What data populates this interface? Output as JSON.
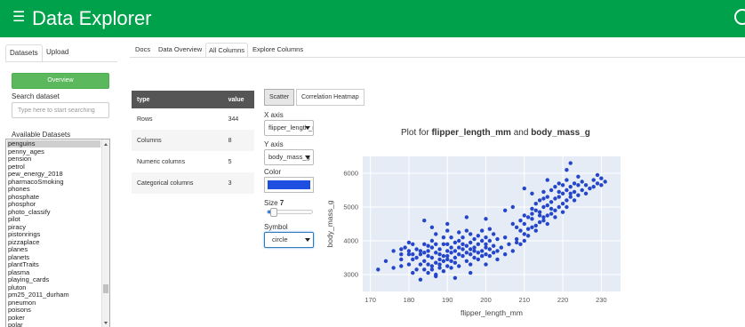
{
  "app": {
    "title": "Data Explorer"
  },
  "sidebar": {
    "tabs": [
      "Datasets",
      "Upload"
    ],
    "overview_button": "Overview",
    "search_label": "Search dataset",
    "search_placeholder": "Type here to start searching",
    "available_label": "Available Datasets",
    "datasets": [
      "penguins",
      "penny_ages",
      "pension",
      "petrol",
      "pew_energy_2018",
      "pharmacoSmoking",
      "phones",
      "phosphate",
      "phosphor",
      "photo_classify",
      "pilot",
      "piracy",
      "pistonrings",
      "pizzaplace",
      "planes",
      "planets",
      "plantTraits",
      "plasma",
      "playing_cards",
      "pluton",
      "pm25_2011_durham",
      "pneumon",
      "poisons",
      "poker",
      "polar"
    ],
    "selected": "penguins"
  },
  "main_tabs": [
    "Docs",
    "Data Overview",
    "All Columns",
    "Explore Columns"
  ],
  "active_main_tab": "All Columns",
  "summary_table": {
    "headers": [
      "type",
      "value"
    ],
    "rows": [
      [
        "Rows",
        "344"
      ],
      [
        "Columns",
        "8"
      ],
      [
        "Numeric columns",
        "5"
      ],
      [
        "Categorical columns",
        "3"
      ]
    ]
  },
  "controls": {
    "tabs": [
      "Scatter",
      "Correlation Heatmap"
    ],
    "x_label": "X axis",
    "x_value": "flipper_length_mm",
    "y_label": "Y axis",
    "y_value": "body_mass_g",
    "color_label": "Color",
    "color_value": "#1f4fe0",
    "size_label": "Size",
    "size_value": "7",
    "size_fraction": 0.12,
    "symbol_label": "Symbol",
    "symbol_value": "circle"
  },
  "plot": {
    "title_prefix": "Plot for ",
    "title_x": "flipper_length_mm",
    "title_and": " and ",
    "title_y": "body_mass_g"
  },
  "chart_data": {
    "type": "scatter",
    "title": "Plot for flipper_length_mm and body_mass_g",
    "xlabel": "flipper_length_mm",
    "ylabel": "body_mass_g",
    "xlim": [
      168,
      235
    ],
    "ylim": [
      2500,
      6500
    ],
    "xticks": [
      170,
      180,
      190,
      200,
      210,
      220,
      230
    ],
    "yticks": [
      3000,
      4000,
      5000,
      6000
    ],
    "grid": true,
    "marker_color": "#2546c9",
    "background": "#e5ecf6",
    "points": [
      [
        172,
        3150
      ],
      [
        174,
        3400
      ],
      [
        176,
        3200
      ],
      [
        178,
        3250
      ],
      [
        178,
        3600
      ],
      [
        178,
        3450
      ],
      [
        179,
        3800
      ],
      [
        180,
        3700
      ],
      [
        180,
        3300
      ],
      [
        180,
        3600
      ],
      [
        180,
        3950
      ],
      [
        181,
        3450
      ],
      [
        181,
        3600
      ],
      [
        181,
        3050
      ],
      [
        182,
        3150
      ],
      [
        182,
        3500
      ],
      [
        182,
        3750
      ],
      [
        183,
        3600
      ],
      [
        183,
        3300
      ],
      [
        183,
        3700
      ],
      [
        184,
        3400
      ],
      [
        184,
        3150
      ],
      [
        184,
        3650
      ],
      [
        184,
        3900
      ],
      [
        185,
        3300
      ],
      [
        185,
        3550
      ],
      [
        185,
        3700
      ],
      [
        185,
        3050
      ],
      [
        185,
        3850
      ],
      [
        186,
        3500
      ],
      [
        186,
        3800
      ],
      [
        186,
        3250
      ],
      [
        186,
        3150
      ],
      [
        186,
        4000
      ],
      [
        187,
        3350
      ],
      [
        187,
        3650
      ],
      [
        187,
        3900
      ],
      [
        187,
        3000
      ],
      [
        187,
        4200
      ],
      [
        188,
        3450
      ],
      [
        188,
        3300
      ],
      [
        188,
        3750
      ],
      [
        188,
        3600
      ],
      [
        188,
        3200
      ],
      [
        189,
        3550
      ],
      [
        189,
        3900
      ],
      [
        189,
        3400
      ],
      [
        189,
        3100
      ],
      [
        189,
        4100
      ],
      [
        190,
        3250
      ],
      [
        190,
        3700
      ],
      [
        190,
        3450
      ],
      [
        190,
        3900
      ],
      [
        190,
        3550
      ],
      [
        190,
        4300
      ],
      [
        191,
        3650
      ],
      [
        191,
        3400
      ],
      [
        191,
        3800
      ],
      [
        191,
        3200
      ],
      [
        191,
        4100
      ],
      [
        192,
        3500
      ],
      [
        192,
        3950
      ],
      [
        192,
        3700
      ],
      [
        192,
        3350
      ],
      [
        193,
        3600
      ],
      [
        193,
        3800
      ],
      [
        193,
        4000
      ],
      [
        193,
        3250
      ],
      [
        193,
        4250
      ],
      [
        194,
        3750
      ],
      [
        194,
        3550
      ],
      [
        194,
        3900
      ],
      [
        194,
        4100
      ],
      [
        195,
        3400
      ],
      [
        195,
        3650
      ],
      [
        195,
        3850
      ],
      [
        195,
        4300
      ],
      [
        196,
        3600
      ],
      [
        196,
        3750
      ],
      [
        196,
        3950
      ],
      [
        196,
        4200
      ],
      [
        196,
        3300
      ],
      [
        197,
        3500
      ],
      [
        197,
        3800
      ],
      [
        197,
        4050
      ],
      [
        197,
        3700
      ],
      [
        198,
        3650
      ],
      [
        198,
        3900
      ],
      [
        198,
        3450
      ],
      [
        198,
        4150
      ],
      [
        199,
        3700
      ],
      [
        199,
        4000
      ],
      [
        199,
        3550
      ],
      [
        199,
        4300
      ],
      [
        200,
        3600
      ],
      [
        200,
        3900
      ],
      [
        200,
        4100
      ],
      [
        200,
        3800
      ],
      [
        201,
        3550
      ],
      [
        201,
        3750
      ],
      [
        201,
        4000
      ],
      [
        201,
        4350
      ],
      [
        202,
        3650
      ],
      [
        202,
        3850
      ],
      [
        202,
        4200
      ],
      [
        203,
        3450
      ],
      [
        203,
        3700
      ],
      [
        203,
        4050
      ],
      [
        204,
        3800
      ],
      [
        205,
        3600
      ],
      [
        205,
        4100
      ],
      [
        206,
        3900
      ],
      [
        207,
        3700
      ],
      [
        207,
        4500
      ],
      [
        208,
        4050
      ],
      [
        208,
        4400
      ],
      [
        208,
        3950
      ],
      [
        209,
        4300
      ],
      [
        209,
        4600
      ],
      [
        209,
        3900
      ],
      [
        210,
        4200
      ],
      [
        210,
        4500
      ],
      [
        210,
        4750
      ],
      [
        210,
        4000
      ],
      [
        211,
        4350
      ],
      [
        211,
        4700
      ],
      [
        211,
        4150
      ],
      [
        212,
        4400
      ],
      [
        212,
        4800
      ],
      [
        212,
        4950
      ],
      [
        212,
        4650
      ],
      [
        213,
        4450
      ],
      [
        213,
        4900
      ],
      [
        213,
        5100
      ],
      [
        213,
        4300
      ],
      [
        214,
        4550
      ],
      [
        214,
        4850
      ],
      [
        214,
        5200
      ],
      [
        214,
        4750
      ],
      [
        215,
        4600
      ],
      [
        215,
        5000
      ],
      [
        215,
        5250
      ],
      [
        215,
        5450
      ],
      [
        215,
        4700
      ],
      [
        216,
        4750
      ],
      [
        216,
        5050
      ],
      [
        216,
        5300
      ],
      [
        216,
        4500
      ],
      [
        217,
        4800
      ],
      [
        217,
        5150
      ],
      [
        217,
        5500
      ],
      [
        217,
        4950
      ],
      [
        218,
        4900
      ],
      [
        218,
        5250
      ],
      [
        218,
        5600
      ],
      [
        218,
        4700
      ],
      [
        219,
        5000
      ],
      [
        219,
        5300
      ],
      [
        219,
        5700
      ],
      [
        219,
        5450
      ],
      [
        220,
        5100
      ],
      [
        220,
        5400
      ],
      [
        220,
        5650
      ],
      [
        220,
        4850
      ],
      [
        221,
        5200
      ],
      [
        221,
        5500
      ],
      [
        221,
        5800
      ],
      [
        221,
        5000
      ],
      [
        222,
        5300
      ],
      [
        222,
        5600
      ],
      [
        222,
        5400
      ],
      [
        223,
        5450
      ],
      [
        223,
        5700
      ],
      [
        223,
        5200
      ],
      [
        224,
        5350
      ],
      [
        224,
        5650
      ],
      [
        224,
        5900
      ],
      [
        225,
        5500
      ],
      [
        225,
        5750
      ],
      [
        226,
        5400
      ],
      [
        226,
        5650
      ],
      [
        227,
        5550
      ],
      [
        228,
        5600
      ],
      [
        228,
        5800
      ],
      [
        229,
        5700
      ],
      [
        229,
        5950
      ],
      [
        230,
        5650
      ],
      [
        230,
        5850
      ],
      [
        231,
        5750
      ],
      [
        222,
        6300
      ],
      [
        221,
        6100
      ],
      [
        216,
        5800
      ],
      [
        212,
        5400
      ],
      [
        210,
        5550
      ],
      [
        207,
        5000
      ],
      [
        205,
        4900
      ],
      [
        200,
        4650
      ],
      [
        195,
        4700
      ],
      [
        190,
        4500
      ],
      [
        186,
        4400
      ],
      [
        184,
        4600
      ],
      [
        200,
        3300
      ],
      [
        196,
        3050
      ],
      [
        192,
        2900
      ],
      [
        187,
        2950
      ],
      [
        183,
        2850
      ],
      [
        181,
        3900
      ],
      [
        178,
        3750
      ],
      [
        176,
        3700
      ]
    ]
  }
}
